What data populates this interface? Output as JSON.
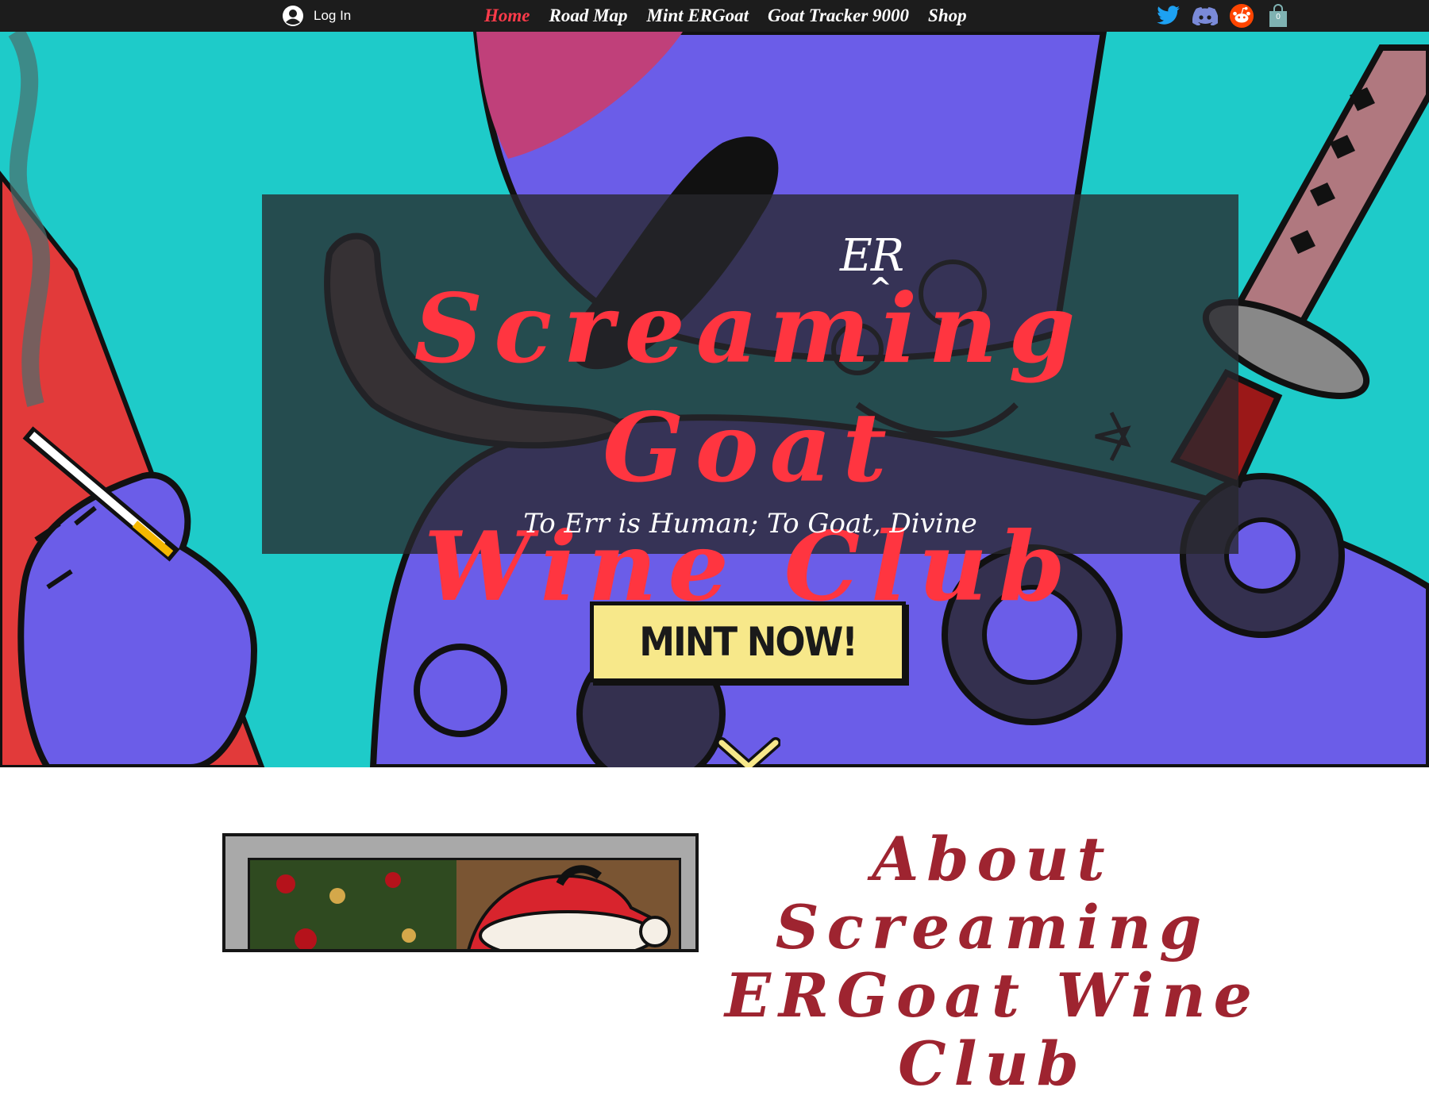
{
  "header": {
    "login_label": "Log In",
    "nav": [
      {
        "label": "Home",
        "active": true
      },
      {
        "label": "Road Map",
        "active": false
      },
      {
        "label": "Mint ERGoat",
        "active": false
      },
      {
        "label": "Goat Tracker 9000",
        "active": false
      },
      {
        "label": "Shop",
        "active": false
      }
    ],
    "socials": [
      "twitter-icon",
      "discord-icon",
      "reddit-icon"
    ],
    "cart_count": "0",
    "active_color": "#ff3b4a",
    "bar_color": "#1c1c1c"
  },
  "hero": {
    "er_mark": "ER",
    "caret": "^",
    "title_line1": "Screaming Goat",
    "title_line2": "Wine Club",
    "tagline": "To Err is Human; To Goat, Divine",
    "cta_label": "MINT NOW!",
    "title_color": "#ff3540",
    "cta_color": "#f7e88a"
  },
  "about": {
    "title_line1": "About Screaming",
    "title_line2": "ERGoat Wine Club",
    "title_color": "#9e2430"
  }
}
